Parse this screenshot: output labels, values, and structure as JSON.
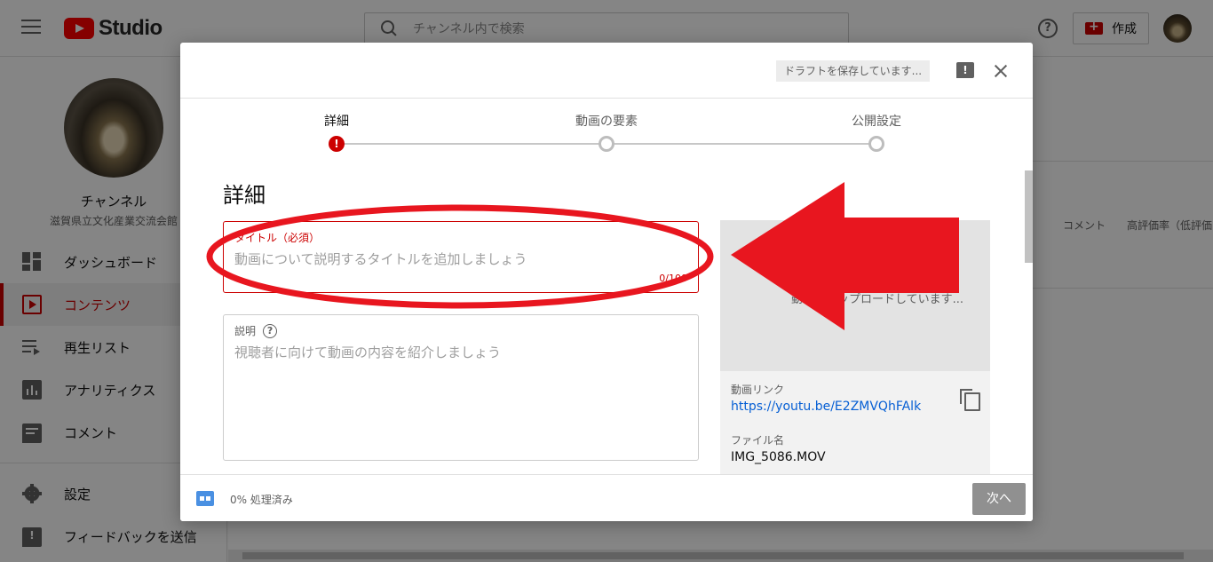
{
  "app": {
    "logo_text": "Studio",
    "search_placeholder": "チャンネル内で検索",
    "help_glyph": "?",
    "create_label": "作成"
  },
  "sidebar": {
    "channel_name": "チャンネル",
    "channel_subtitle": "滋賀県立文化産業交流会館",
    "items": [
      {
        "label": "ダッシュボード",
        "icon": "dashboard-icon"
      },
      {
        "label": "コンテンツ",
        "icon": "content-icon",
        "active": true
      },
      {
        "label": "再生リスト",
        "icon": "playlist-icon"
      },
      {
        "label": "アナリティクス",
        "icon": "analytics-icon"
      },
      {
        "label": "コメント",
        "icon": "comment-icon"
      },
      {
        "label": "設定",
        "icon": "gear-icon"
      },
      {
        "label": "フィードバックを送信",
        "icon": "feedback-icon"
      }
    ]
  },
  "background_table": {
    "columns": [
      "コメント",
      "高評価率（低評価"
    ]
  },
  "dialog": {
    "draft_status": "ドラフトを保存しています...",
    "feedback_glyph": "!",
    "steps": [
      {
        "label": "詳細",
        "state": "error"
      },
      {
        "label": "動画の要素",
        "state": "pending"
      },
      {
        "label": "公開設定",
        "state": "pending"
      }
    ],
    "error_glyph": "!",
    "section_title": "詳細",
    "title_field": {
      "label": "タイトル（必須）",
      "placeholder": "動画について説明するタイトルを追加しましょう",
      "counter": "0/100"
    },
    "description_field": {
      "label": "説明",
      "help_glyph": "?",
      "placeholder": "視聴者に向けて動画の内容を紹介しましょう"
    },
    "preview": {
      "status": "動画をアップロードしています...",
      "link_label": "動画リンク",
      "link_url": "https://youtu.be/E2ZMVQhFAlk",
      "file_label": "ファイル名",
      "file_name": "IMG_5086.MOV"
    },
    "footer": {
      "processing_text": "0% 処理済み",
      "next_label": "次へ"
    }
  },
  "annotation": {
    "color": "#e8161f"
  }
}
